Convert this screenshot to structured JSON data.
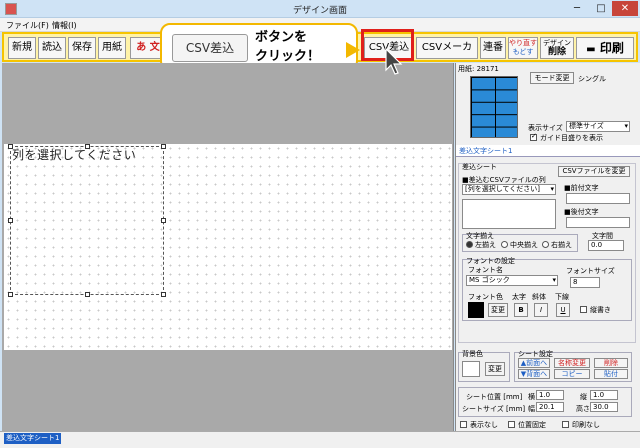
{
  "window": {
    "title": "デザイン画面",
    "min": "─",
    "max": "□",
    "close": "✕"
  },
  "menu": [
    "ファイル(F)",
    "情報(I)"
  ],
  "toolbar": {
    "new": "新規",
    "read": "読込",
    "save": "保存",
    "paper": "用紙",
    "text": "あ 文",
    "csv": "CSV差込",
    "csvmaker": "CSVメーカー",
    "renban": "連番",
    "redo_top": "やり直す",
    "redo_bottom": "もどす",
    "delete_top": "デザイン",
    "delete_bottom": "削除",
    "print": "印刷"
  },
  "callout": {
    "button": "CSV差込",
    "line1": "ボタンを",
    "line2": "クリック！"
  },
  "canvas": {
    "field_text": "列を選択してください"
  },
  "panel": {
    "paper_label": "用紙: 28171",
    "mode_change": "モード変更",
    "mode_value": "シングル",
    "display_size_label": "表示サイズ",
    "display_size_value": "標準サイズ",
    "guide_label": "ガイド目盛りを表示",
    "sheet_tab": "差込文字シート1",
    "insert_sheet_label": "差込シート",
    "csv_change": "CSVファイルを変更",
    "insert_col_label": "■差込むCSVファイルの列",
    "insert_col_value": "[列を選択してください]",
    "prefix_label": "■前付文字",
    "suffix_label": "■後付文字",
    "align_label": "文字揃え",
    "align_left": "左揃え",
    "align_center": "中央揃え",
    "align_right": "右揃え",
    "spacing_label": "文字間",
    "spacing_value": "0.0",
    "font_settings_label": "フォントの設定",
    "font_name_label": "フォント名",
    "font_name_value": "MS ゴシック",
    "font_size_label": "フォントサイズ",
    "font_size_value": "8",
    "font_color_label": "フォント色",
    "bold_label": "太字",
    "italic_label": "斜体",
    "underline_label": "下線",
    "color_change": "変更",
    "bold_btn": "B",
    "italic_btn": "I",
    "underline_btn": "U",
    "vertical_label": "縦書き",
    "bg_color_label": "背景色",
    "bg_change": "変更",
    "sheet_settings_label": "シート設定",
    "move_front": "▲前面へ",
    "move_back": "▼背面へ",
    "rename": "名称変更",
    "copy": "コピー",
    "delete_top": "削除",
    "paste": "貼付",
    "pos_label": "シート位置 [mm]",
    "x_label": "横",
    "x_value": "1.0",
    "y_label": "縦",
    "y_value": "1.0",
    "size_label": "シートサイズ [mm]",
    "w_label": "幅",
    "w_value": "20.1",
    "h_label": "高さ",
    "h_value": "30.0",
    "hide_label": "表示なし",
    "fix_label": "位置固定",
    "noprint_label": "印刷なし"
  },
  "status": {
    "tab": "差込文字シート1"
  }
}
